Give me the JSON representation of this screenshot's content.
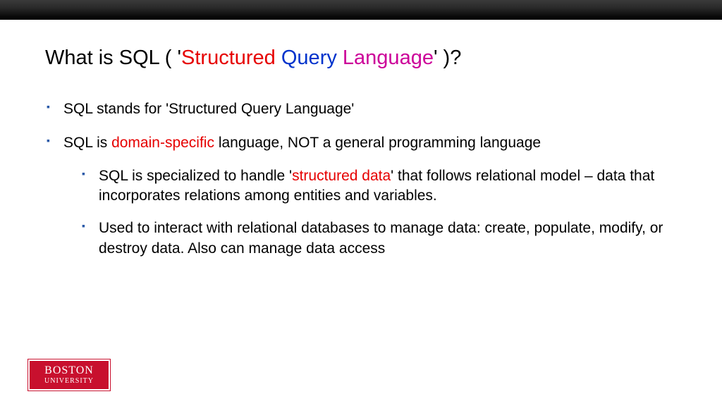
{
  "title": {
    "prefix": "What is SQL ( ",
    "quote_open": "'",
    "word_structured": "Structured",
    "word_query": "Query",
    "word_language": "Language",
    "quote_close": "'",
    "suffix": " )?"
  },
  "bullets": {
    "b1": "SQL stands for 'Structured Query Language'",
    "b2_pre": "SQL is ",
    "b2_hl": "domain-specific",
    "b2_post": " language, NOT a general programming language",
    "b2_sub1_pre": "SQL is specialized to handle '",
    "b2_sub1_hl": "structured data",
    "b2_sub1_post": "' that follows relational model – data that incorporates relations among entities and variables.",
    "b2_sub2": "Used to interact with relational databases to manage data: create, populate, modify, or destroy data.  Also can manage data access"
  },
  "logo": {
    "line1": "BOSTON",
    "line2": "UNIVERSITY"
  }
}
